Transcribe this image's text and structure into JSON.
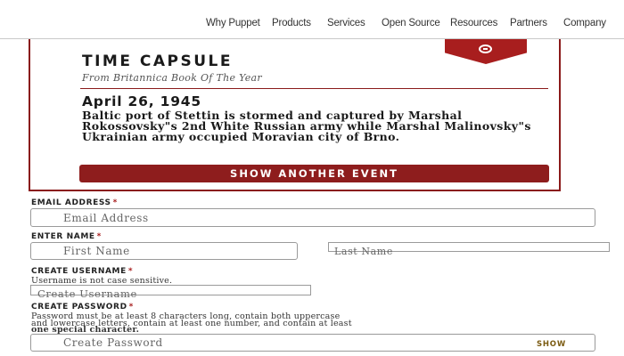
{
  "nav": {
    "items": [
      "Why Puppet",
      "Products",
      "Services",
      "Open Source",
      "Resources",
      "Partners",
      "Company"
    ]
  },
  "capsule": {
    "icon": "chat-bubble-icon",
    "title": "TIME CAPSULE",
    "subtitle": "From Britannica Book Of The Year",
    "date": "April 26, 1945",
    "body": "Baltic port of Stettin is stormed and captured by Marshal Rokossovsky\"s 2nd White Russian army while Marshal Malinovsky\"s Ukrainian army occupied Moravian city of Brno.",
    "button_label": "SHOW ANOTHER EVENT"
  },
  "form": {
    "email": {
      "label": "EMAIL ADDRESS",
      "required": "*",
      "placeholder": "Email Address",
      "value": ""
    },
    "name": {
      "label": "ENTER NAME",
      "required": "*",
      "first_placeholder": "First Name",
      "last_placeholder": "Last Name"
    },
    "username": {
      "label": "CREATE USERNAME",
      "required": "*",
      "hint": "Username is not case sensitive.",
      "placeholder": "Create Username"
    },
    "password": {
      "label": "CREATE PASSWORD",
      "required": "*",
      "hint_line1": "Password must be at least 8 characters long, contain both uppercase",
      "hint_line2": "and lowercase letters, contain at least one number, and contain at least",
      "hint_line3": "one special character.",
      "placeholder": "Create Password",
      "show_label": "SHOW"
    }
  },
  "colors": {
    "accent": "#a81e1e",
    "button": "#8e1d1d",
    "border": "#9a9a9a"
  }
}
